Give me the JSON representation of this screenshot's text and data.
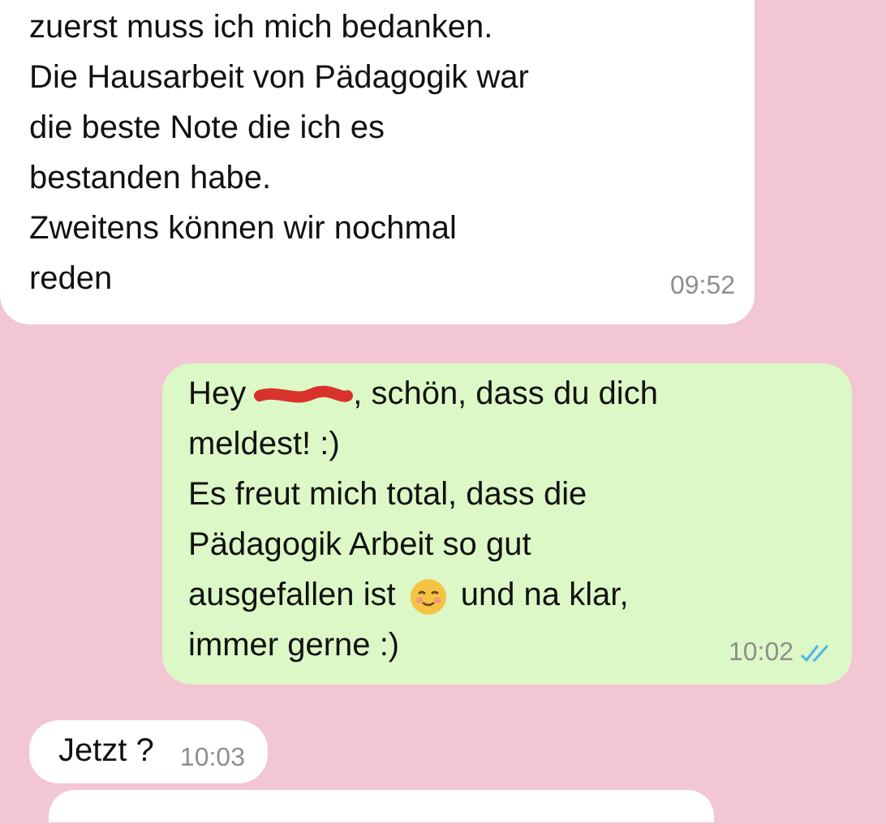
{
  "messages": [
    {
      "kind": "incoming",
      "lines": [
        [
          {
            "kind": "text",
            "text": "zuerst muss ich mich bedanken."
          }
        ],
        [
          {
            "kind": "text",
            "text": "Die Hausarbeit von Pädagogik war"
          }
        ],
        [
          {
            "kind": "text",
            "text": "die beste Note die ich es"
          }
        ],
        [
          {
            "kind": "text",
            "text": "bestanden habe."
          }
        ],
        [
          {
            "kind": "text",
            "text": "Zweitens können wir nochmal"
          }
        ],
        [
          {
            "kind": "text",
            "text": "reden"
          }
        ]
      ],
      "time": "09:52"
    },
    {
      "kind": "outgoing",
      "lines": [
        [
          {
            "kind": "text",
            "text": "Hey"
          },
          {
            "kind": "redaction"
          },
          {
            "kind": "text",
            "text": ", schön, dass du dich"
          }
        ],
        [
          {
            "kind": "text",
            "text": "meldest! :)"
          }
        ],
        [
          {
            "kind": "text",
            "text": "Es freut mich total, dass die"
          }
        ],
        [
          {
            "kind": "text",
            "text": "Pädagogik Arbeit so gut"
          }
        ],
        [
          {
            "kind": "text",
            "text": "ausgefallen ist"
          },
          {
            "kind": "emoji"
          },
          {
            "kind": "text",
            "text": "und na klar,"
          }
        ],
        [
          {
            "kind": "text",
            "text": "immer gerne :)"
          }
        ]
      ],
      "time": "10:02",
      "read": true
    },
    {
      "kind": "incoming",
      "lines": [
        [
          {
            "kind": "text",
            "text": "Jetzt ?"
          }
        ]
      ],
      "time": "10:03"
    },
    {
      "kind": "cut-off"
    }
  ]
}
